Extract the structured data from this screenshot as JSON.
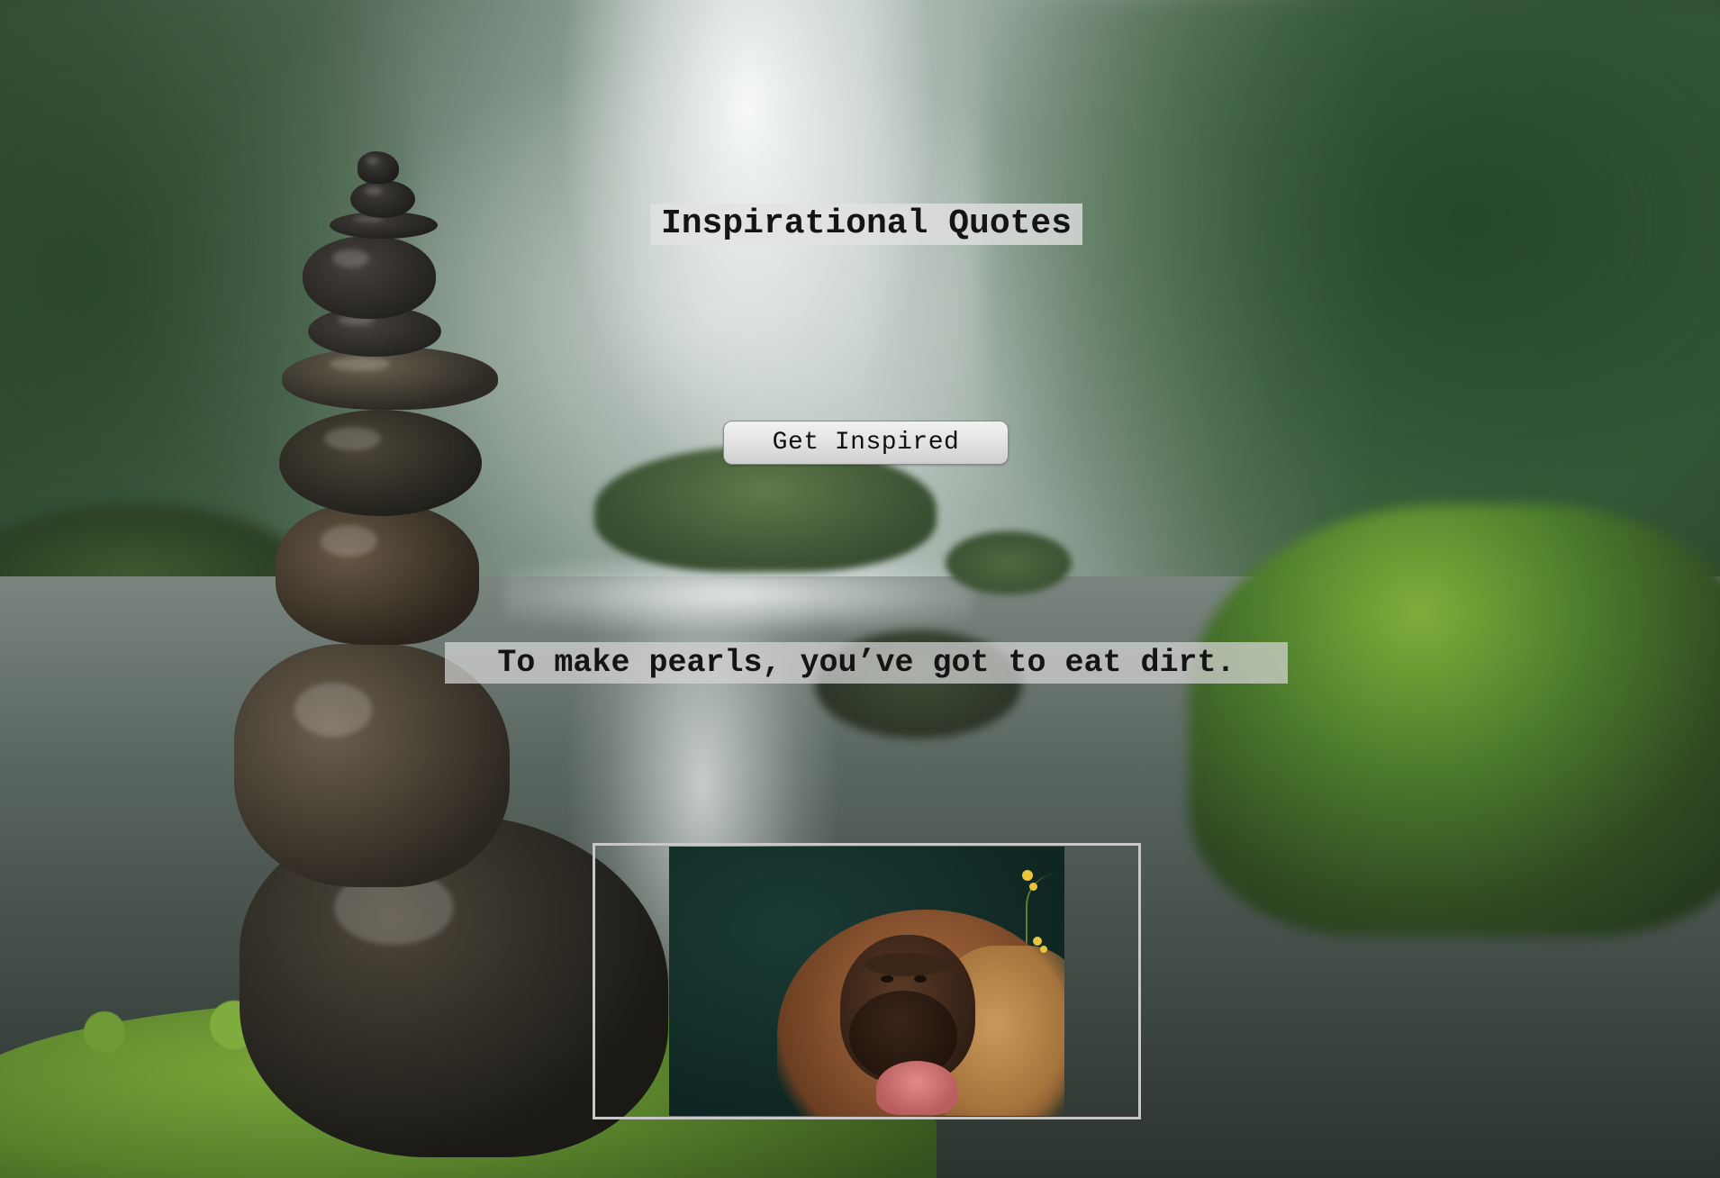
{
  "page": {
    "title": "Inspirational Quotes",
    "button_label": "Get Inspired",
    "quote": "To make pearls, you’ve got to eat dirt.",
    "quote_image_subject": "gelada-monkey"
  },
  "colors": {
    "title_background": "#e2e2e2",
    "quote_background": "#d6d6d6",
    "button_background": "#e1e1e1",
    "text": "#141414",
    "image_frame_border": "#c8c8c8"
  },
  "icons": {
    "background": "stone-cairn-river-scene"
  }
}
